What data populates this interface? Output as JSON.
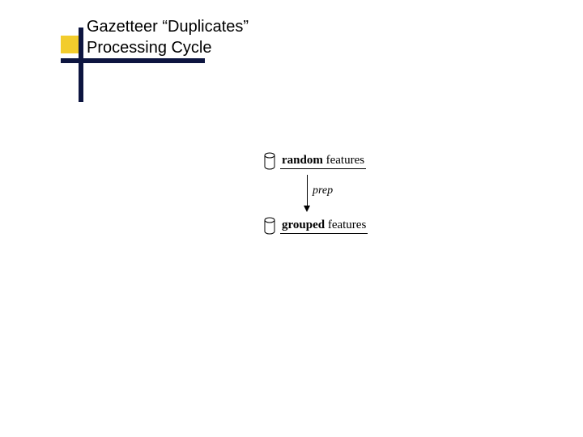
{
  "colors": {
    "accent_yellow": "#f2cc2d",
    "accent_navy": "#0d1540"
  },
  "title": {
    "line1": "Gazetteer “Duplicates”",
    "line2": "Processing Cycle"
  },
  "flow": {
    "node1": {
      "strong": "random",
      "rest": " features"
    },
    "edge1": {
      "label": "prep"
    },
    "node2": {
      "strong": "grouped",
      "rest": " features"
    }
  }
}
